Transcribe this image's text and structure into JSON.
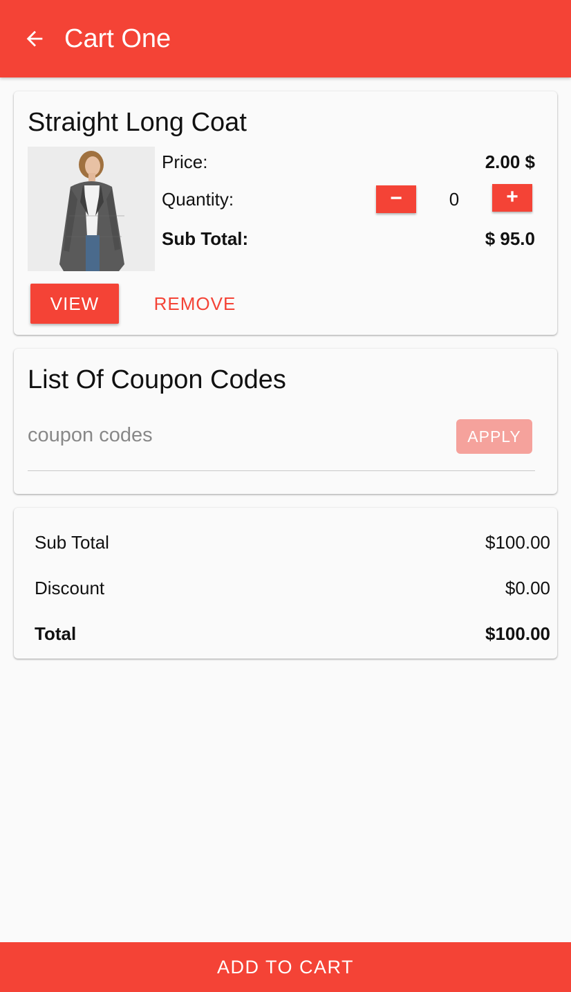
{
  "appbar": {
    "title": "Cart One",
    "back_icon": "arrow-left-icon",
    "color": "#f44336"
  },
  "cart_item": {
    "name": "Straight Long Coat",
    "price_label": "Price:",
    "price_value": "2.00 $",
    "quantity_label": "Quantity:",
    "quantity_value": "0",
    "minus_label": "−",
    "plus_label": "+",
    "subtotal_label": "Sub Total:",
    "subtotal_value": "$ 95.0",
    "view_label": "VIEW",
    "remove_label": "REMOVE"
  },
  "coupons": {
    "title": "List Of Coupon Codes",
    "placeholder": "coupon codes",
    "value": "",
    "apply_label": "APPLY"
  },
  "summary": {
    "subtotal_label": "Sub Total",
    "subtotal_value": "$100.00",
    "discount_label": "Discount",
    "discount_value": "$0.00",
    "total_label": "Total",
    "total_value": "$100.00"
  },
  "footer": {
    "add_to_cart_label": "ADD TO CART"
  }
}
